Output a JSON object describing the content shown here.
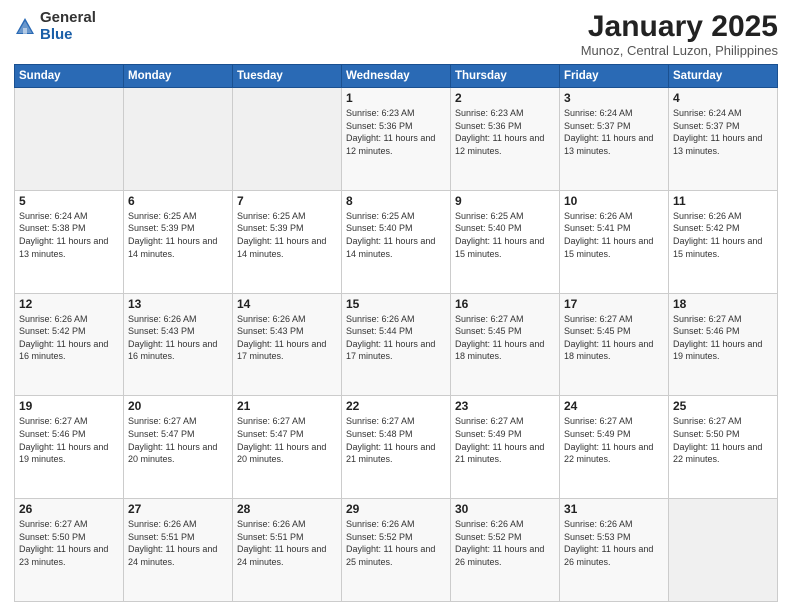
{
  "logo": {
    "general": "General",
    "blue": "Blue"
  },
  "title": {
    "month": "January 2025",
    "location": "Munoz, Central Luzon, Philippines"
  },
  "weekdays": [
    "Sunday",
    "Monday",
    "Tuesday",
    "Wednesday",
    "Thursday",
    "Friday",
    "Saturday"
  ],
  "weeks": [
    [
      {
        "day": "",
        "sunrise": "",
        "sunset": "",
        "daylight": ""
      },
      {
        "day": "",
        "sunrise": "",
        "sunset": "",
        "daylight": ""
      },
      {
        "day": "",
        "sunrise": "",
        "sunset": "",
        "daylight": ""
      },
      {
        "day": "1",
        "sunrise": "Sunrise: 6:23 AM",
        "sunset": "Sunset: 5:36 PM",
        "daylight": "Daylight: 11 hours and 12 minutes."
      },
      {
        "day": "2",
        "sunrise": "Sunrise: 6:23 AM",
        "sunset": "Sunset: 5:36 PM",
        "daylight": "Daylight: 11 hours and 12 minutes."
      },
      {
        "day": "3",
        "sunrise": "Sunrise: 6:24 AM",
        "sunset": "Sunset: 5:37 PM",
        "daylight": "Daylight: 11 hours and 13 minutes."
      },
      {
        "day": "4",
        "sunrise": "Sunrise: 6:24 AM",
        "sunset": "Sunset: 5:37 PM",
        "daylight": "Daylight: 11 hours and 13 minutes."
      }
    ],
    [
      {
        "day": "5",
        "sunrise": "Sunrise: 6:24 AM",
        "sunset": "Sunset: 5:38 PM",
        "daylight": "Daylight: 11 hours and 13 minutes."
      },
      {
        "day": "6",
        "sunrise": "Sunrise: 6:25 AM",
        "sunset": "Sunset: 5:39 PM",
        "daylight": "Daylight: 11 hours and 14 minutes."
      },
      {
        "day": "7",
        "sunrise": "Sunrise: 6:25 AM",
        "sunset": "Sunset: 5:39 PM",
        "daylight": "Daylight: 11 hours and 14 minutes."
      },
      {
        "day": "8",
        "sunrise": "Sunrise: 6:25 AM",
        "sunset": "Sunset: 5:40 PM",
        "daylight": "Daylight: 11 hours and 14 minutes."
      },
      {
        "day": "9",
        "sunrise": "Sunrise: 6:25 AM",
        "sunset": "Sunset: 5:40 PM",
        "daylight": "Daylight: 11 hours and 15 minutes."
      },
      {
        "day": "10",
        "sunrise": "Sunrise: 6:26 AM",
        "sunset": "Sunset: 5:41 PM",
        "daylight": "Daylight: 11 hours and 15 minutes."
      },
      {
        "day": "11",
        "sunrise": "Sunrise: 6:26 AM",
        "sunset": "Sunset: 5:42 PM",
        "daylight": "Daylight: 11 hours and 15 minutes."
      }
    ],
    [
      {
        "day": "12",
        "sunrise": "Sunrise: 6:26 AM",
        "sunset": "Sunset: 5:42 PM",
        "daylight": "Daylight: 11 hours and 16 minutes."
      },
      {
        "day": "13",
        "sunrise": "Sunrise: 6:26 AM",
        "sunset": "Sunset: 5:43 PM",
        "daylight": "Daylight: 11 hours and 16 minutes."
      },
      {
        "day": "14",
        "sunrise": "Sunrise: 6:26 AM",
        "sunset": "Sunset: 5:43 PM",
        "daylight": "Daylight: 11 hours and 17 minutes."
      },
      {
        "day": "15",
        "sunrise": "Sunrise: 6:26 AM",
        "sunset": "Sunset: 5:44 PM",
        "daylight": "Daylight: 11 hours and 17 minutes."
      },
      {
        "day": "16",
        "sunrise": "Sunrise: 6:27 AM",
        "sunset": "Sunset: 5:45 PM",
        "daylight": "Daylight: 11 hours and 18 minutes."
      },
      {
        "day": "17",
        "sunrise": "Sunrise: 6:27 AM",
        "sunset": "Sunset: 5:45 PM",
        "daylight": "Daylight: 11 hours and 18 minutes."
      },
      {
        "day": "18",
        "sunrise": "Sunrise: 6:27 AM",
        "sunset": "Sunset: 5:46 PM",
        "daylight": "Daylight: 11 hours and 19 minutes."
      }
    ],
    [
      {
        "day": "19",
        "sunrise": "Sunrise: 6:27 AM",
        "sunset": "Sunset: 5:46 PM",
        "daylight": "Daylight: 11 hours and 19 minutes."
      },
      {
        "day": "20",
        "sunrise": "Sunrise: 6:27 AM",
        "sunset": "Sunset: 5:47 PM",
        "daylight": "Daylight: 11 hours and 20 minutes."
      },
      {
        "day": "21",
        "sunrise": "Sunrise: 6:27 AM",
        "sunset": "Sunset: 5:47 PM",
        "daylight": "Daylight: 11 hours and 20 minutes."
      },
      {
        "day": "22",
        "sunrise": "Sunrise: 6:27 AM",
        "sunset": "Sunset: 5:48 PM",
        "daylight": "Daylight: 11 hours and 21 minutes."
      },
      {
        "day": "23",
        "sunrise": "Sunrise: 6:27 AM",
        "sunset": "Sunset: 5:49 PM",
        "daylight": "Daylight: 11 hours and 21 minutes."
      },
      {
        "day": "24",
        "sunrise": "Sunrise: 6:27 AM",
        "sunset": "Sunset: 5:49 PM",
        "daylight": "Daylight: 11 hours and 22 minutes."
      },
      {
        "day": "25",
        "sunrise": "Sunrise: 6:27 AM",
        "sunset": "Sunset: 5:50 PM",
        "daylight": "Daylight: 11 hours and 22 minutes."
      }
    ],
    [
      {
        "day": "26",
        "sunrise": "Sunrise: 6:27 AM",
        "sunset": "Sunset: 5:50 PM",
        "daylight": "Daylight: 11 hours and 23 minutes."
      },
      {
        "day": "27",
        "sunrise": "Sunrise: 6:26 AM",
        "sunset": "Sunset: 5:51 PM",
        "daylight": "Daylight: 11 hours and 24 minutes."
      },
      {
        "day": "28",
        "sunrise": "Sunrise: 6:26 AM",
        "sunset": "Sunset: 5:51 PM",
        "daylight": "Daylight: 11 hours and 24 minutes."
      },
      {
        "day": "29",
        "sunrise": "Sunrise: 6:26 AM",
        "sunset": "Sunset: 5:52 PM",
        "daylight": "Daylight: 11 hours and 25 minutes."
      },
      {
        "day": "30",
        "sunrise": "Sunrise: 6:26 AM",
        "sunset": "Sunset: 5:52 PM",
        "daylight": "Daylight: 11 hours and 26 minutes."
      },
      {
        "day": "31",
        "sunrise": "Sunrise: 6:26 AM",
        "sunset": "Sunset: 5:53 PM",
        "daylight": "Daylight: 11 hours and 26 minutes."
      },
      {
        "day": "",
        "sunrise": "",
        "sunset": "",
        "daylight": ""
      }
    ]
  ]
}
